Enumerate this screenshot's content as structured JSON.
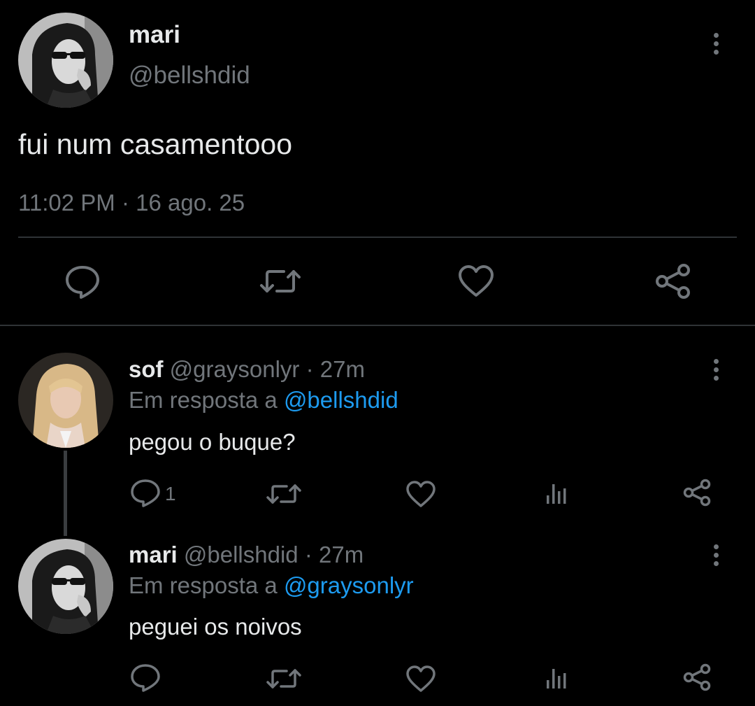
{
  "main_tweet": {
    "name": "mari",
    "handle": "@bellshdid",
    "text": "fui num casamentooo",
    "time": "11:02 PM",
    "separator": "·",
    "date": "16 ago. 25",
    "actions": [
      "reply-icon",
      "retweet-icon",
      "like-icon",
      "share-icon"
    ]
  },
  "replies": [
    {
      "name": "sof",
      "handle": "@graysonlyr",
      "separator": "·",
      "age": "27m",
      "reply_to_label": "Em resposta a",
      "reply_to_handle": "@bellshdid",
      "text": "pegou o buque?",
      "reply_count": "1",
      "actions": [
        "reply-icon",
        "retweet-icon",
        "like-icon",
        "views-icon",
        "share-icon"
      ]
    },
    {
      "name": "mari",
      "handle": "@bellshdid",
      "separator": "·",
      "age": "27m",
      "reply_to_label": "Em resposta a",
      "reply_to_handle": "@graysonlyr",
      "text": "peguei os noivos",
      "actions": [
        "reply-icon",
        "retweet-icon",
        "like-icon",
        "views-icon",
        "share-icon"
      ]
    }
  ],
  "colors": {
    "background": "#000000",
    "text_primary": "#e7e9ea",
    "text_secondary": "#71767b",
    "link": "#1d9bf0",
    "divider": "#2f3336"
  }
}
